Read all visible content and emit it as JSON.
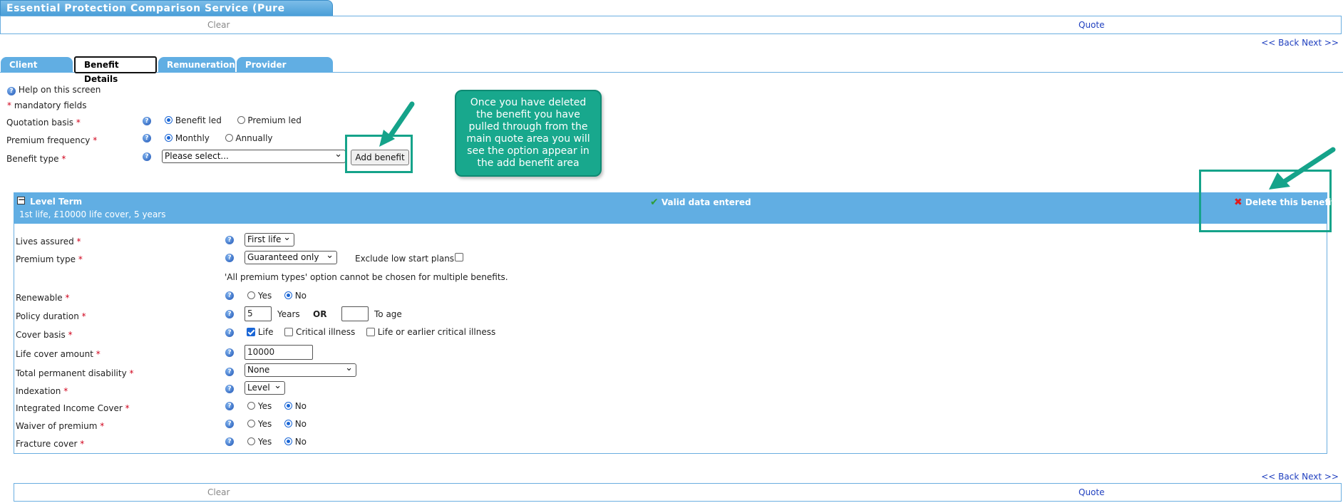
{
  "app": {
    "title": "Essential Protection Comparison Service (Pure Protection)"
  },
  "topbar": {
    "clear": "Clear",
    "quote": "Quote"
  },
  "nav": {
    "back": "<< Back",
    "next": "Next >>"
  },
  "tabs": [
    {
      "label": "Client Details",
      "active": false
    },
    {
      "label": "Benefit Details",
      "active": true
    },
    {
      "label": "Remuneration",
      "active": false
    },
    {
      "label": "Provider Selection",
      "active": false
    }
  ],
  "help": {
    "text": "Help on this screen",
    "mandatory": "mandatory fields",
    "asterisk": "*"
  },
  "form": {
    "quotation_basis": {
      "label": "Quotation basis",
      "options": [
        "Benefit led",
        "Premium led"
      ],
      "selected": "Benefit led"
    },
    "premium_frequency": {
      "label": "Premium frequency",
      "options": [
        "Monthly",
        "Annually"
      ],
      "selected": "Monthly"
    },
    "benefit_type": {
      "label": "Benefit type",
      "value": "Please select...",
      "add_button": "Add benefit"
    }
  },
  "callout": {
    "text": "Once you have deleted the benefit you have pulled through from the main quote area you will see the option appear in the add benefit area"
  },
  "benefit": {
    "title": "Level Term",
    "summary": "1st life, £10000 life cover, 5 years",
    "status": "Valid data entered",
    "delete_label": "Delete this benefit",
    "fields": {
      "lives_assured": {
        "label": "Lives assured",
        "value": "First life"
      },
      "premium_type": {
        "label": "Premium type",
        "value": "Guaranteed only",
        "exclude_label": "Exclude low start plans",
        "exclude_checked": false,
        "note": "'All premium types' option cannot be chosen for multiple benefits."
      },
      "renewable": {
        "label": "Renewable",
        "yes": "Yes",
        "no": "No",
        "selected": "No"
      },
      "policy_duration": {
        "label": "Policy duration",
        "years_value": "5",
        "years_label": "Years",
        "or_label": "OR",
        "age_value": "",
        "age_label": "To age"
      },
      "cover_basis": {
        "label": "Cover basis",
        "options": [
          "Life",
          "Critical illness",
          "Life or earlier critical illness"
        ],
        "checked": [
          "Life"
        ]
      },
      "life_cover_amount": {
        "label": "Life cover amount",
        "value": "10000"
      },
      "tpd": {
        "label": "Total permanent disability",
        "value": "None"
      },
      "indexation": {
        "label": "Indexation",
        "value": "Level"
      },
      "integrated_income_cover": {
        "label": "Integrated Income Cover",
        "yes": "Yes",
        "no": "No",
        "selected": "No"
      },
      "waiver_of_premium": {
        "label": "Waiver of premium",
        "yes": "Yes",
        "no": "No",
        "selected": "No"
      },
      "fracture_cover": {
        "label": "Fracture cover",
        "yes": "Yes",
        "no": "No",
        "selected": "No"
      }
    }
  },
  "bottombar": {
    "clear": "Clear",
    "quote": "Quote"
  },
  "colors": {
    "accent": "#61aee3",
    "highlight": "#15a38a",
    "link": "#1f3fbf",
    "required": "#d0021b"
  }
}
